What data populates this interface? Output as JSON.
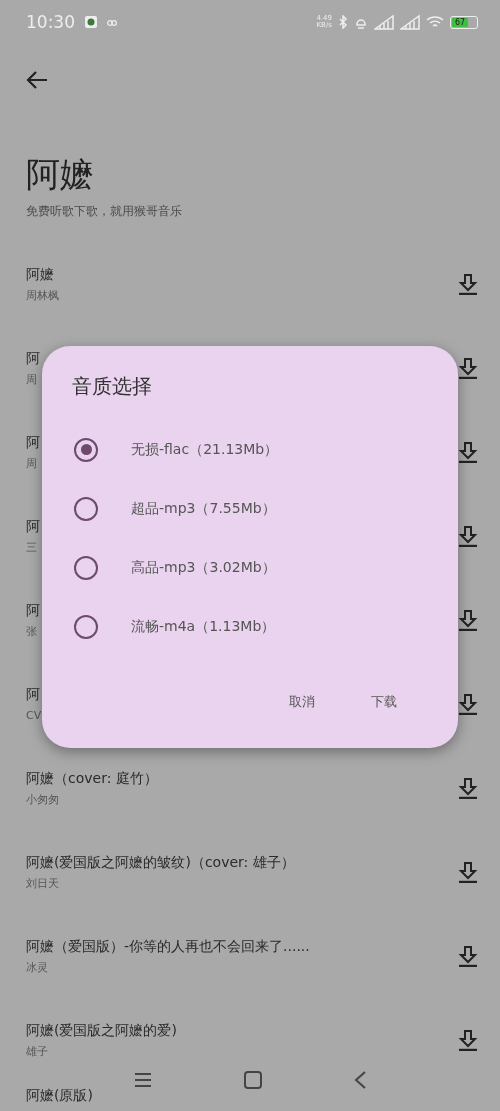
{
  "status_bar": {
    "time": "10:30",
    "net_speed": "4.49",
    "net_unit": "KB/s",
    "battery": "67"
  },
  "header": {
    "title": "阿嬷",
    "subtitle": "免费听歌下歌，就用猴哥音乐"
  },
  "songs": [
    {
      "title": "阿嬷",
      "artist": "周林枫"
    },
    {
      "title": "阿",
      "artist": "周"
    },
    {
      "title": "阿",
      "artist": "周"
    },
    {
      "title": "阿",
      "artist": "三"
    },
    {
      "title": "阿",
      "artist": "张"
    },
    {
      "title": "阿",
      "artist": "CV"
    },
    {
      "title": "阿嬷（cover: 庭竹）",
      "artist": "小匆匆"
    },
    {
      "title": "阿嬷(爱国版之阿嬷的皱纹)（cover: 雄子）",
      "artist": "刘日天"
    },
    {
      "title": "阿嬷（爱国版）-你等的人再也不会回来了......",
      "artist": "冰灵"
    },
    {
      "title": "阿嬷(爱国版之阿嬷的爱)",
      "artist": "雄子"
    },
    {
      "title": "阿嬷(原版)"
    }
  ],
  "dialog": {
    "title": "音质选择",
    "options": [
      {
        "label": "无损-flac（21.13Mb）",
        "selected": true
      },
      {
        "label": "超品-mp3（7.55Mb）",
        "selected": false
      },
      {
        "label": "高品-mp3（3.02Mb）",
        "selected": false
      },
      {
        "label": "流畅-m4a（1.13Mb）",
        "selected": false
      }
    ],
    "buttons": [
      "取消",
      "下载"
    ]
  }
}
